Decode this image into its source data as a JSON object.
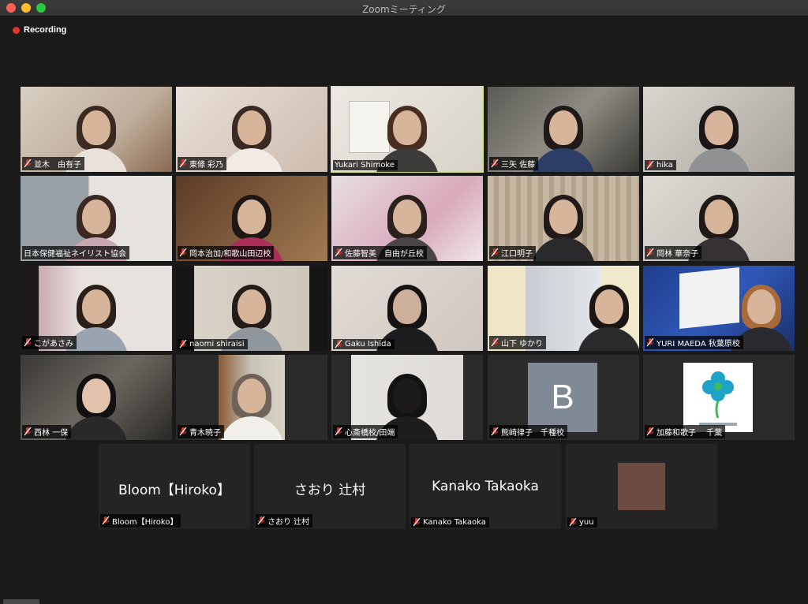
{
  "window": {
    "title": "Zoomミーティング"
  },
  "recording": {
    "label": "Recording"
  },
  "colors": {
    "active_border": "#d5e37a",
    "recording_dot": "#e0352b",
    "muted_mic": "#e0352b"
  },
  "participants": [
    {
      "name": "並木　由有子"
    },
    {
      "name": "東條 彩乃"
    },
    {
      "name": "Yukari Shimoke"
    },
    {
      "name": "三矢 佐藤"
    },
    {
      "name": "hika"
    },
    {
      "name": "日本保健福祉ネイリスト協会"
    },
    {
      "name": "岡本治加/和歌山田辺校"
    },
    {
      "name": "佐藤智美　自由が丘校"
    },
    {
      "name": "江口明子"
    },
    {
      "name": "岡林 華奈子"
    },
    {
      "name": "こがあさみ"
    },
    {
      "name": "naomi shiraisi"
    },
    {
      "name": "Gaku Ishida"
    },
    {
      "name": "山下 ゆかり"
    },
    {
      "name": "YURI MAEDA 秋葉原校"
    },
    {
      "name": "西林 一保"
    },
    {
      "name": "青木暁子"
    },
    {
      "name": "心斎橋校/田端"
    },
    {
      "name": "熊崎律子　千種校",
      "avatar_letter": "B"
    },
    {
      "name": "加藤和歌子　 千葉"
    },
    {
      "name": "Bloom【Hiroko】",
      "display": "Bloom【Hiroko】"
    },
    {
      "name": "さおり 辻村",
      "display": "さおり 辻村"
    },
    {
      "name": "Kanako Takaoka",
      "display": "Kanako Takaoka"
    },
    {
      "name": "yuu"
    }
  ]
}
